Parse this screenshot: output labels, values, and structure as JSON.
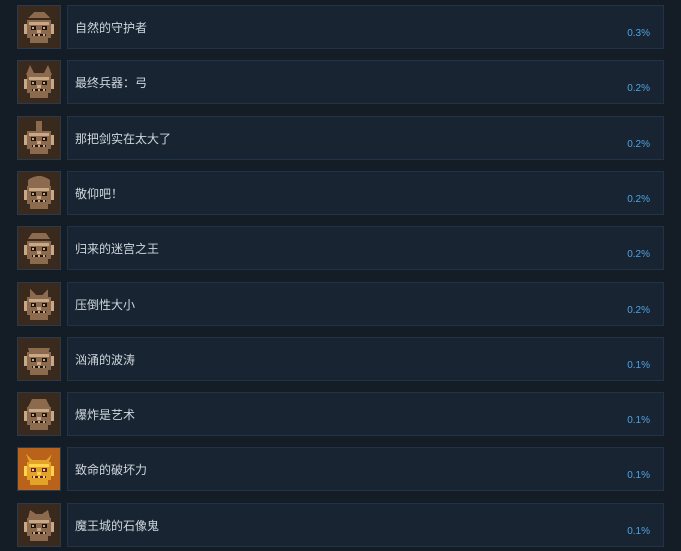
{
  "achievements": [
    {
      "name": "自然的守护者",
      "percent": "0.3%",
      "icon": "stone-guardian-icon",
      "colors": {
        "bg": "#3a2a1e",
        "main": "#8b6a4e",
        "hi": "#c9a887",
        "dark": "#1e140e"
      }
    },
    {
      "name": "最终兵器：弓",
      "percent": "0.2%",
      "icon": "horned-bow-beast-icon",
      "colors": {
        "bg": "#3a2a1e",
        "main": "#8b6a4e",
        "hi": "#c9a887",
        "dark": "#1e140e"
      }
    },
    {
      "name": "那把剑实在太大了",
      "percent": "0.2%",
      "icon": "sword-beast-icon",
      "colors": {
        "bg": "#3a2a1e",
        "main": "#8b6a4e",
        "hi": "#c9a887",
        "dark": "#1e140e"
      }
    },
    {
      "name": "敬仰吧！",
      "percent": "0.2%",
      "icon": "round-golem-icon",
      "colors": {
        "bg": "#3a2a1e",
        "main": "#8b6a4e",
        "hi": "#c9a887",
        "dark": "#1e140e"
      }
    },
    {
      "name": "归来的迷宫之王",
      "percent": "0.2%",
      "icon": "labyrinth-king-icon",
      "colors": {
        "bg": "#3a2a1e",
        "main": "#8b6a4e",
        "hi": "#c9a887",
        "dark": "#1e140e"
      }
    },
    {
      "name": "压倒性大小",
      "percent": "0.2%",
      "icon": "giant-beast-icon",
      "colors": {
        "bg": "#3a2a1e",
        "main": "#8b6a4e",
        "hi": "#c9a887",
        "dark": "#1e140e"
      }
    },
    {
      "name": "汹涌的波涛",
      "percent": "0.1%",
      "icon": "wave-skull-icon",
      "colors": {
        "bg": "#3a2a1e",
        "main": "#8b6a4e",
        "hi": "#c9a887",
        "dark": "#1e140e"
      }
    },
    {
      "name": "爆炸是艺术",
      "percent": "0.1%",
      "icon": "bomb-mask-icon",
      "colors": {
        "bg": "#3a2a1e",
        "main": "#8b6a4e",
        "hi": "#c9a887",
        "dark": "#1e140e"
      }
    },
    {
      "name": "致命的破坏力",
      "percent": "0.1%",
      "icon": "golden-demon-icon",
      "colors": {
        "bg": "#b8621a",
        "main": "#e3a328",
        "hi": "#ffd44a",
        "dark": "#5a1e3a"
      }
    },
    {
      "name": "魔王城的石像鬼",
      "percent": "0.1%",
      "icon": "gargoyle-icon",
      "colors": {
        "bg": "#3a2a1e",
        "main": "#8b6a4e",
        "hi": "#c9a887",
        "dark": "#1e140e"
      }
    }
  ]
}
